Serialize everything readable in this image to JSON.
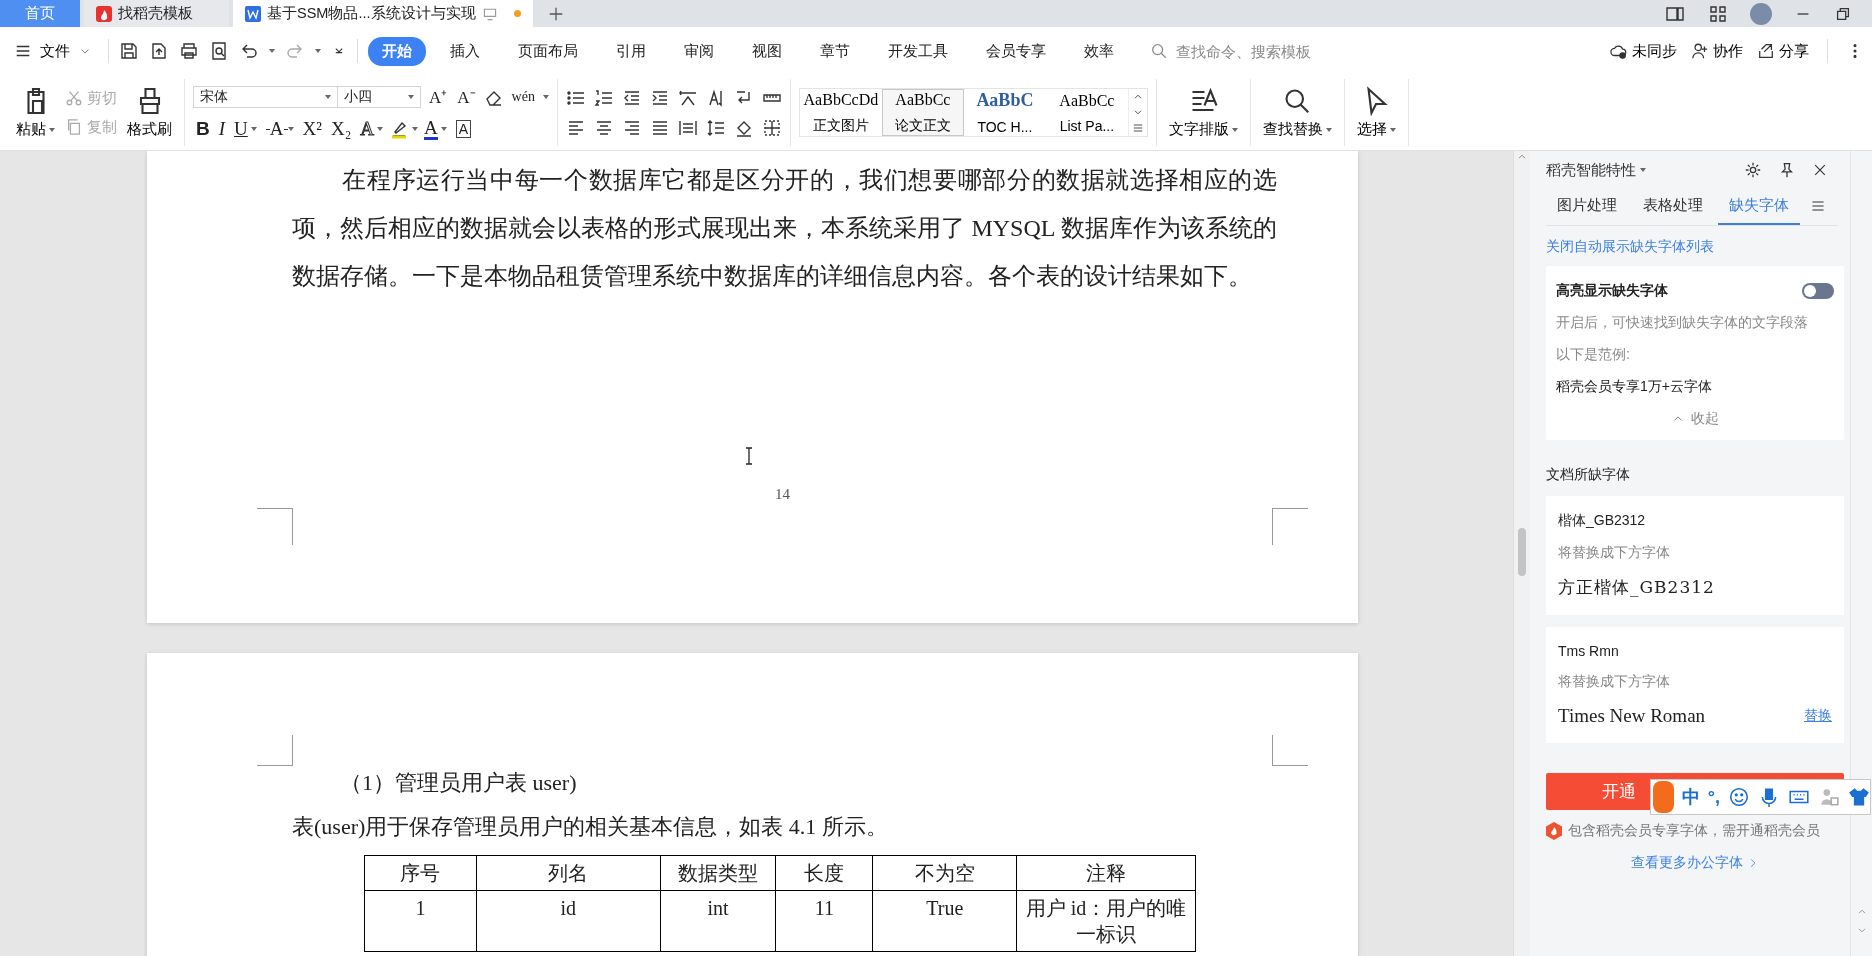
{
  "tabs": [
    {
      "kind": "home",
      "label": "首页",
      "selected": false,
      "unsaved": false
    },
    {
      "kind": "template",
      "label": "找稻壳模板",
      "selected": false,
      "unsaved": false
    },
    {
      "kind": "document",
      "label": "基于SSM物品...系统设计与实现",
      "selected": true,
      "unsaved": true
    }
  ],
  "menu": {
    "file": "文件",
    "ribbon_tabs": [
      {
        "label": "开始",
        "selected": true
      },
      {
        "label": "插入",
        "selected": false
      },
      {
        "label": "页面布局",
        "selected": false
      },
      {
        "label": "引用",
        "selected": false
      },
      {
        "label": "审阅",
        "selected": false
      },
      {
        "label": "视图",
        "selected": false
      },
      {
        "label": "章节",
        "selected": false
      },
      {
        "label": "开发工具",
        "selected": false
      },
      {
        "label": "会员专享",
        "selected": false
      },
      {
        "label": "效率",
        "selected": false
      }
    ],
    "search": {
      "placeholder": "查找命令、搜索模板"
    },
    "actions": [
      {
        "kind": "sync",
        "label": "未同步"
      },
      {
        "kind": "collab",
        "label": "协作"
      },
      {
        "kind": "share",
        "label": "分享"
      }
    ]
  },
  "ribbon": {
    "clipboard": {
      "paste": "粘贴",
      "cut": "剪切",
      "cut_disabled": true,
      "copy": "复制",
      "copy_disabled": true,
      "format_painter": "格式刷"
    },
    "font": {
      "name": "宋体",
      "size": "小四",
      "grow": "A⁺",
      "shrink": "A⁻",
      "phonetic": "wén",
      "format_buttons": [
        {
          "glyph": "B",
          "kind": "bold",
          "menu": false
        },
        {
          "glyph": "I",
          "kind": "italic",
          "menu": false
        },
        {
          "glyph": "U",
          "kind": "underline",
          "menu": true
        },
        {
          "glyph": "A",
          "kind": "strike",
          "menu": true
        },
        {
          "glyph": "X²",
          "kind": "plain",
          "menu": false
        },
        {
          "glyph": "X₂",
          "kind": "plain",
          "menu": false
        },
        {
          "glyph": "A",
          "kind": "outline",
          "menu": true
        },
        {
          "glyph": "A",
          "kind": "color",
          "menu": true
        },
        {
          "glyph": "A",
          "kind": "boxed",
          "menu": false
        }
      ]
    },
    "styles": [
      {
        "preview": "AaBbCcDd",
        "name": "正文图片",
        "kind": "normal",
        "selected": false
      },
      {
        "preview": "AaBbCc",
        "name": "论文正文",
        "kind": "normal",
        "selected": true
      },
      {
        "preview": "AaBbC",
        "name": "TOC H...",
        "kind": "heading",
        "selected": false
      },
      {
        "preview": "AaBbCc",
        "name": "List Pa...",
        "kind": "normal",
        "selected": false
      }
    ],
    "big_tools": [
      {
        "kind": "text-layout",
        "label": "文字排版"
      },
      {
        "kind": "find",
        "label": "查找替换"
      },
      {
        "kind": "select",
        "label": "选择"
      }
    ]
  },
  "document": {
    "page1": {
      "paragraph": "在程序运行当中每一个数据库它都是区分开的，我们想要哪部分的数据就选择相应的选项，然后相应的数据就会以表格的形式展现出来，本系统采用了 MYSQL 数据库作为该系统的数据存储。一下是本物品租赁管理系统中数据库的详细信息内容。各个表的设计结果如下。",
      "page_number": "14"
    },
    "page2": {
      "heading": "（1）管理员用户表 user)",
      "paragraph": "表(user)用于保存管理员用户的相关基本信息，如表 4.1 所示。",
      "table": {
        "columns": [
          "序号",
          "列名",
          "数据类型",
          "长度",
          "不为空",
          "注释"
        ],
        "rows": [
          [
            "1",
            "id",
            "int",
            "11",
            "True",
            "用户 id：用户的唯一标识"
          ]
        ]
      }
    }
  },
  "panel": {
    "title": "稻壳智能特性",
    "tabs": [
      {
        "label": "图片处理",
        "selected": false
      },
      {
        "label": "表格处理",
        "selected": false
      },
      {
        "label": "缺失字体",
        "selected": true
      }
    ],
    "close_auto_link": "关闭自动展示缺失字体列表",
    "highlight": {
      "label": "高亮显示缺失字体",
      "on": false,
      "description": "开启后，可快速找到缺失字体的文字段落",
      "example_label": "以下是范例:",
      "example": "稻壳会员专享1万+云字体",
      "collapse": "收起"
    },
    "missing_title": "文档所缺字体",
    "missing_fonts": [
      {
        "font": "楷体_GB2312",
        "note": "将替换成下方字体",
        "replacement": "方正楷体_GB2312",
        "kind": "kai"
      },
      {
        "font": "Tms Rmn",
        "note": "将替换成下方字体",
        "replacement": "Times New Roman",
        "kind": "serif",
        "action": "替换"
      }
    ],
    "vip_button": "开通",
    "vip_note": "包含稻壳会员专享字体，需开通稻壳会员",
    "more_link": "查看更多办公字体"
  },
  "ime": {
    "mode": "中",
    "punct": "°,"
  }
}
